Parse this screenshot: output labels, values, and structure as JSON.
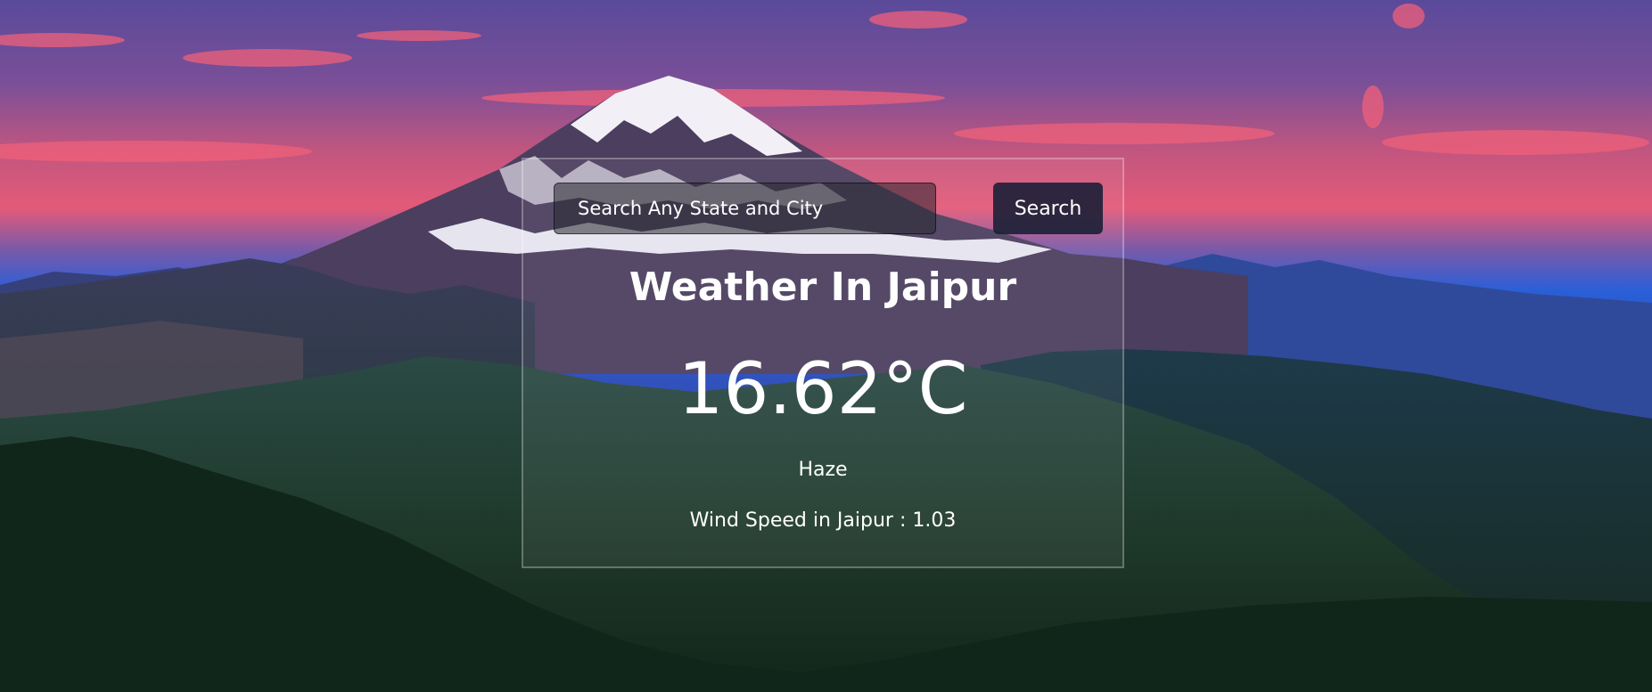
{
  "search": {
    "placeholder": "Search Any State and City",
    "button_label": "Search"
  },
  "weather": {
    "title": "Weather In Jaipur",
    "temperature": "16.62°C",
    "condition": "Haze",
    "wind": "Wind Speed in Jaipur : 1.03"
  },
  "colors": {
    "sky_top": "#5a4a9a",
    "sky_glow": "#e8587a",
    "horizon_blue": "#2a5fd8",
    "forest": "#1f3a2c",
    "button_bg": "#161e34"
  }
}
